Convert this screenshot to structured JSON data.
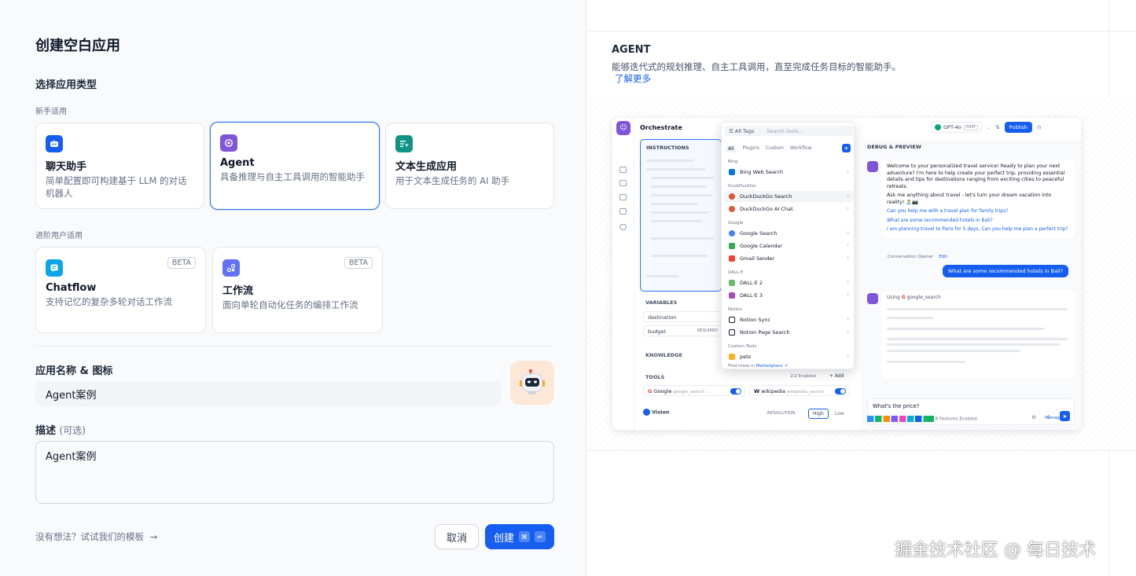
{
  "page_title": "创建空白应用",
  "app_type_section": "选择应用类型",
  "groups": {
    "beginner": "新手适用",
    "advanced": "进阶用户适用"
  },
  "cards": [
    {
      "title": "聊天助手",
      "desc": "简单配置即可构建基于 LLM 的对话机器人",
      "icon": "chat-bot-icon",
      "color": "#155eef"
    },
    {
      "title": "Agent",
      "desc": "具备推理与自主工具调用的智能助手",
      "icon": "agent-icon",
      "color": "#7f56d9",
      "selected": true
    },
    {
      "title": "文本生成应用",
      "desc": "用于文本生成任务的 AI 助手",
      "icon": "text-generation-icon",
      "color": "#0e9384"
    },
    {
      "title": "Chatflow",
      "desc": "支持记忆的复杂多轮对话工作流",
      "icon": "chatflow-icon",
      "color": "#0ba5ec",
      "badge": "BETA"
    },
    {
      "title": "工作流",
      "desc": "面向单轮自动化任务的编排工作流",
      "icon": "workflow-icon",
      "color": "#6172f3",
      "badge": "BETA"
    }
  ],
  "name_section": {
    "label": "应用名称 & 图标",
    "value": "Agent案例"
  },
  "desc_section": {
    "label": "描述",
    "optional": "(可选)",
    "value": "Agent案例"
  },
  "footer": {
    "template_link": "没有想法？试试我们的模板",
    "cancel": "取消",
    "create": "创建",
    "kbd_cmd": "⌘",
    "kbd_enter": "↵"
  },
  "preview": {
    "title": "AGENT",
    "desc": "能够迭代式的规划推理、自主工具调用，直至完成任务目标的智能助手。",
    "link": "了解更多",
    "mock": {
      "orchestrate": "Orchestrate",
      "instructions": "INSTRUCTIONS",
      "variables": "VARIABLES",
      "var1": "destination",
      "var2": "budget",
      "required": "REQUIRED",
      "knowledge": "KNOWLEDGE",
      "tools": "TOOLS",
      "tools_enabled": "2/2 Enabled",
      "add": "+ Add",
      "tool1": "Google",
      "tool1_sub": "google_search",
      "tool2": "wikipedia",
      "tool2_sub": "wikipedia_search",
      "vision": "Vision",
      "resolution": "RESOLUTION",
      "high": "High",
      "low": "Low",
      "all_tags": "All Tags",
      "search_tools": "Search tools...",
      "tabs": [
        "All",
        "Plugins",
        "Custom",
        "Workflow"
      ],
      "dd_groups": [
        "Bing",
        "DuckDuckGo",
        "Google",
        "DALL·E",
        "Notion",
        "Custom Tools"
      ],
      "dd_items": [
        "Bing Web Search",
        "DuckDuckGo Search",
        "DuckDuckGo AI Chat",
        "Google Search",
        "Google Calendar",
        "Gmail Sender",
        "DALL·E 2",
        "DALL·E 3",
        "Notion Sync",
        "Notion Page Search",
        "pets"
      ],
      "find_more": "Find more in",
      "marketplace": "Marketplace ↗",
      "model": "GPT-4o",
      "chat_tag": "CHAT",
      "publish": "Publish",
      "debug": "DEBUG & PREVIEW",
      "welcome": "Welcome to your personalized travel service! Ready to plan your next adventure? I'm here to help create your perfect trip, providing essential details and tips for destinations ranging from exciting cities to peaceful retreats.",
      "ask": "Ask me anything about travel - let's turn your dream vacation into reality! 🏝️📷",
      "s1": "Can you help me with a travel plan for family trips?",
      "s2": "What are some recommended hotels in Bali?",
      "s3": "I am planning travel to Paris for 5 days. Can you help me plan a perfect trip?",
      "opener": "Conversation Opener",
      "edit": "Edit",
      "user_msg": "What are some recommended hotels in Bali?",
      "using": "Using",
      "using_tool": "google_search",
      "chat_input": "What's the price?",
      "features": "8 Features Enabled",
      "manage": "Manage"
    }
  },
  "watermark": "掘金技术社区 @ 每日技术"
}
